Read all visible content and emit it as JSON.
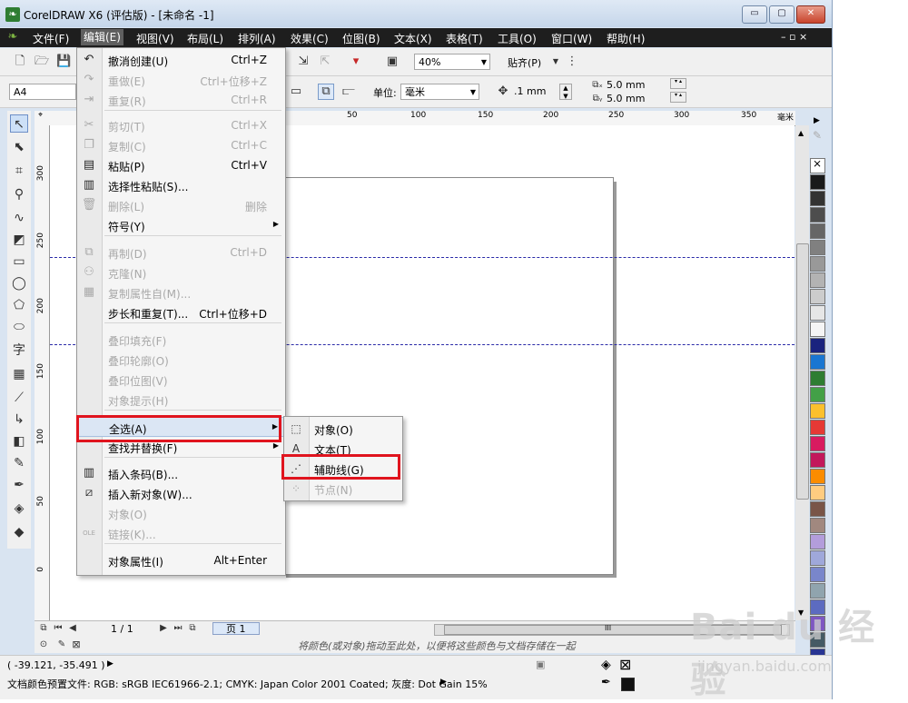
{
  "window": {
    "title": "CorelDRAW X6 (评估版) - [未命名 -1]",
    "controls": {
      "minimize": "▭",
      "maximize": "▢",
      "close": "✕"
    }
  },
  "menubar": {
    "items": [
      "文件(F)",
      "编辑(E)",
      "视图(V)",
      "布局(L)",
      "排列(A)",
      "效果(C)",
      "位图(B)",
      "文本(X)",
      "表格(T)",
      "工具(O)",
      "窗口(W)",
      "帮助(H)"
    ],
    "active_index": 1,
    "doc_controls": "– ▫ ×"
  },
  "toolbar": {
    "zoom_value": "40%",
    "snap_label": "贴齐(P)",
    "page_size_value": "A4",
    "unit_label": "单位:",
    "unit_value": "毫米",
    "nudge_value": ".1 mm",
    "dup_x_value": "5.0 mm",
    "dup_y_value": "5.0 mm"
  },
  "rulers": {
    "top_ticks": [
      "50",
      "100",
      "150",
      "200",
      "250",
      "300",
      "350",
      "毫米"
    ],
    "left_ticks": [
      "300",
      "250",
      "200",
      "150",
      "100",
      "50",
      "0"
    ]
  },
  "edit_menu": {
    "items": [
      {
        "label": "撤消创建(U)",
        "shortcut": "Ctrl+Z",
        "icon": "undo-icon",
        "glyph": "↶",
        "disabled": false
      },
      {
        "label": "重做(E)",
        "shortcut": "Ctrl+位移+Z",
        "icon": "redo-icon",
        "glyph": "↷",
        "disabled": true
      },
      {
        "label": "重复(R)",
        "shortcut": "Ctrl+R",
        "icon": "repeat-icon",
        "glyph": "⇥",
        "disabled": true
      },
      {
        "label": "剪切(T)",
        "shortcut": "Ctrl+X",
        "icon": "cut-icon",
        "glyph": "✂",
        "disabled": true
      },
      {
        "label": "复制(C)",
        "shortcut": "Ctrl+C",
        "icon": "copy-icon",
        "glyph": "❐",
        "disabled": true
      },
      {
        "label": "粘贴(P)",
        "shortcut": "Ctrl+V",
        "icon": "paste-icon",
        "glyph": "▤",
        "disabled": false
      },
      {
        "label": "选择性粘贴(S)...",
        "shortcut": "",
        "icon": "paste-special-icon",
        "glyph": "▥",
        "disabled": false
      },
      {
        "label": "删除(L)",
        "shortcut": "删除",
        "icon": "delete-icon",
        "glyph": "🗑",
        "disabled": true
      },
      {
        "label": "符号(Y)",
        "shortcut": "",
        "icon": "",
        "glyph": "",
        "disabled": false,
        "submenu": true
      },
      {
        "label": "再制(D)",
        "shortcut": "Ctrl+D",
        "icon": "duplicate-icon",
        "glyph": "⧉",
        "disabled": true
      },
      {
        "label": "克隆(N)",
        "shortcut": "",
        "icon": "clone-icon",
        "glyph": "⚇",
        "disabled": true
      },
      {
        "label": "复制属性自(M)...",
        "shortcut": "",
        "icon": "copy-properties-icon",
        "glyph": "▦",
        "disabled": true
      },
      {
        "label": "步长和重复(T)...",
        "shortcut": "Ctrl+位移+D",
        "icon": "",
        "glyph": "",
        "disabled": false
      },
      {
        "label": "叠印填充(F)",
        "shortcut": "",
        "icon": "",
        "glyph": "",
        "disabled": true
      },
      {
        "label": "叠印轮廓(O)",
        "shortcut": "",
        "icon": "",
        "glyph": "",
        "disabled": true
      },
      {
        "label": "叠印位图(V)",
        "shortcut": "",
        "icon": "",
        "glyph": "",
        "disabled": true
      },
      {
        "label": "对象提示(H)",
        "shortcut": "",
        "icon": "",
        "glyph": "",
        "disabled": true
      },
      {
        "label": "全选(A)",
        "shortcut": "",
        "icon": "",
        "glyph": "",
        "disabled": false,
        "submenu": true,
        "highlighted": true
      },
      {
        "label": "查找并替换(F)",
        "shortcut": "",
        "icon": "",
        "glyph": "",
        "disabled": false,
        "submenu": true
      },
      {
        "label": "插入条码(B)...",
        "shortcut": "",
        "icon": "barcode-icon",
        "glyph": "▥",
        "disabled": false
      },
      {
        "label": "插入新对象(W)...",
        "shortcut": "",
        "icon": "insert-object-icon",
        "glyph": "⧄",
        "disabled": false
      },
      {
        "label": "对象(O)",
        "shortcut": "",
        "icon": "",
        "glyph": "",
        "disabled": true
      },
      {
        "label": "链接(K)...",
        "shortcut": "",
        "icon": "link-icon",
        "glyph": "OLE",
        "disabled": true
      },
      {
        "label": "对象属性(I)",
        "shortcut": "Alt+Enter",
        "icon": "",
        "glyph": "",
        "disabled": false
      }
    ]
  },
  "select_all_submenu": {
    "items": [
      {
        "label": "对象(O)",
        "icon": "select-objects-icon",
        "glyph": "⬚",
        "disabled": false
      },
      {
        "label": "文本(T)",
        "icon": "select-text-icon",
        "glyph": "A",
        "disabled": false
      },
      {
        "label": "辅助线(G)",
        "icon": "select-guidelines-icon",
        "glyph": "⋰",
        "disabled": false
      },
      {
        "label": "节点(N)",
        "icon": "select-nodes-icon",
        "glyph": "⁘",
        "disabled": true
      }
    ]
  },
  "page_nav": {
    "counter": "1 / 1",
    "page_tab": "页 1",
    "scroll_grip": "III"
  },
  "hint": "将颜色(或对象)拖动至此处，以便将这些颜色与文档存储在一起",
  "status": {
    "coordinates": "( -39.121, -35.491 )",
    "color_profile": "文档颜色预置文件: RGB: sRGB IEC61966-2.1; CMYK: Japan Color 2001 Coated; 灰度: Dot Gain 15%"
  },
  "palette": [
    "#ffffff",
    "#1a1a1a",
    "#333333",
    "#4d4d4d",
    "#666666",
    "#808080",
    "#999999",
    "#b3b3b3",
    "#cccccc",
    "#e6e6e6",
    "#f5f5f5",
    "#1a237e",
    "#1976d2",
    "#2e7d32",
    "#43a047",
    "#fbc02d",
    "#e53935",
    "#d81b60",
    "#c2185b",
    "#fb8c00",
    "#ffcc80",
    "#795548",
    "#a1887f",
    "#b39ddb",
    "#9fa8da",
    "#7986cb",
    "#90a4ae",
    "#5c6bc0",
    "#7e57c2",
    "#455a64",
    "#283593"
  ],
  "colors": {
    "highlight_box": "#e0141e",
    "guideline": "#2a2aa8",
    "menubar_bg": "#1e1e1e"
  },
  "watermark": {
    "brand": "Bai du 经验",
    "url": "jingyan.baidu.com"
  }
}
